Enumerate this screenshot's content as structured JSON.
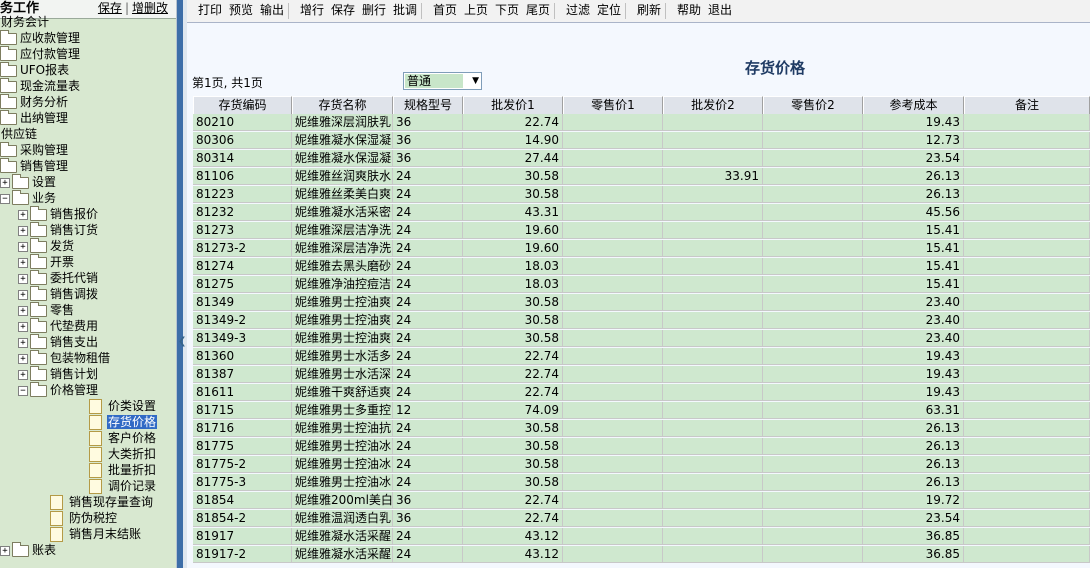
{
  "left_panel": {
    "title": "务工作",
    "save_label": "保存",
    "addremove_label": "增删改",
    "tree": [
      {
        "label": "财务会计",
        "depth": 0,
        "icon": "none",
        "expander": ""
      },
      {
        "label": "应收款管理",
        "depth": 1,
        "icon": "folder",
        "expander": ""
      },
      {
        "label": "应付款管理",
        "depth": 1,
        "icon": "folder",
        "expander": ""
      },
      {
        "label": "UFO报表",
        "depth": 1,
        "icon": "folder",
        "expander": ""
      },
      {
        "label": "现金流量表",
        "depth": 1,
        "icon": "folder",
        "expander": ""
      },
      {
        "label": "财务分析",
        "depth": 1,
        "icon": "folder",
        "expander": ""
      },
      {
        "label": "出纳管理",
        "depth": 1,
        "icon": "folder",
        "expander": ""
      },
      {
        "label": "供应链",
        "depth": 0,
        "icon": "none",
        "expander": ""
      },
      {
        "label": "采购管理",
        "depth": 1,
        "icon": "folder",
        "expander": ""
      },
      {
        "label": "销售管理",
        "depth": 1,
        "icon": "folder",
        "expander": ""
      },
      {
        "label": "设置",
        "depth": 2,
        "icon": "folder",
        "expander": "+"
      },
      {
        "label": "业务",
        "depth": 2,
        "icon": "folder",
        "expander": "-"
      },
      {
        "label": "销售报价",
        "depth": 3,
        "icon": "folder",
        "expander": "+"
      },
      {
        "label": "销售订货",
        "depth": 3,
        "icon": "folder",
        "expander": "+"
      },
      {
        "label": "发货",
        "depth": 3,
        "icon": "folder",
        "expander": "+"
      },
      {
        "label": "开票",
        "depth": 3,
        "icon": "folder",
        "expander": "+"
      },
      {
        "label": "委托代销",
        "depth": 3,
        "icon": "folder",
        "expander": "+"
      },
      {
        "label": "销售调拨",
        "depth": 3,
        "icon": "folder",
        "expander": "+"
      },
      {
        "label": "零售",
        "depth": 3,
        "icon": "folder",
        "expander": "+"
      },
      {
        "label": "代垫费用",
        "depth": 3,
        "icon": "folder",
        "expander": "+"
      },
      {
        "label": "销售支出",
        "depth": 3,
        "icon": "folder",
        "expander": "+"
      },
      {
        "label": "包装物租借",
        "depth": 3,
        "icon": "folder",
        "expander": "+"
      },
      {
        "label": "销售计划",
        "depth": 3,
        "icon": "folder",
        "expander": "+"
      },
      {
        "label": "价格管理",
        "depth": 3,
        "icon": "folder",
        "expander": "-"
      },
      {
        "label": "价类设置",
        "depth": 4,
        "icon": "doc",
        "expander": ""
      },
      {
        "label": "存货价格",
        "depth": 4,
        "icon": "doc",
        "expander": "",
        "selected": true
      },
      {
        "label": "客户价格",
        "depth": 4,
        "icon": "doc",
        "expander": ""
      },
      {
        "label": "大类折扣",
        "depth": 4,
        "icon": "doc",
        "expander": ""
      },
      {
        "label": "批量折扣",
        "depth": 4,
        "icon": "doc",
        "expander": ""
      },
      {
        "label": "调价记录",
        "depth": 4,
        "icon": "doc",
        "expander": ""
      },
      {
        "label": "销售现存量查询",
        "depth": 3,
        "icon": "doc",
        "expander": ""
      },
      {
        "label": "防伪税控",
        "depth": 3,
        "icon": "doc",
        "expander": ""
      },
      {
        "label": "销售月末结账",
        "depth": 3,
        "icon": "doc",
        "expander": ""
      },
      {
        "label": "账表",
        "depth": 2,
        "icon": "folder",
        "expander": "+"
      }
    ]
  },
  "toolbar": {
    "groups": [
      [
        "打印",
        "预览",
        "输出"
      ],
      [
        "增行",
        "保存",
        "删行",
        "批调"
      ],
      [
        "首页",
        "上页",
        "下页",
        "尾页"
      ],
      [
        "过滤",
        "定位"
      ],
      [
        "刷新"
      ],
      [
        "帮助",
        "退出"
      ]
    ]
  },
  "report": {
    "title": "存货价格",
    "page_info": "第1页, 共1页",
    "type_select": "普通"
  },
  "grid": {
    "columns": [
      "存货编码",
      "存货名称",
      "规格型号",
      "批发价1",
      "零售价1",
      "批发价2",
      "零售价2",
      "参考成本",
      "备注"
    ],
    "rows": [
      [
        "80210",
        "妮维雅深层润肤乳",
        "36",
        "22.74",
        "",
        "",
        "",
        "19.43",
        ""
      ],
      [
        "80306",
        "妮维雅凝水保湿凝",
        "36",
        "14.90",
        "",
        "",
        "",
        "12.73",
        ""
      ],
      [
        "80314",
        "妮维雅凝水保湿凝",
        "36",
        "27.44",
        "",
        "",
        "",
        "23.54",
        ""
      ],
      [
        "81106",
        "妮维雅丝润爽肤水",
        "24",
        "30.58",
        "",
        "33.91",
        "",
        "26.13",
        ""
      ],
      [
        "81223",
        "妮维雅丝柔美白爽",
        "24",
        "30.58",
        "",
        "",
        "",
        "26.13",
        ""
      ],
      [
        "81232",
        "妮维雅凝水活采密",
        "24",
        "43.31",
        "",
        "",
        "",
        "45.56",
        ""
      ],
      [
        "81273",
        "妮维雅深层洁净洗",
        "24",
        "19.60",
        "",
        "",
        "",
        "15.41",
        ""
      ],
      [
        "81273-2",
        "妮维雅深层洁净洗",
        "24",
        "19.60",
        "",
        "",
        "",
        "15.41",
        ""
      ],
      [
        "81274",
        "妮维雅去黑头磨砂",
        "24",
        "18.03",
        "",
        "",
        "",
        "15.41",
        ""
      ],
      [
        "81275",
        "妮维雅净油控痘洁",
        "24",
        "18.03",
        "",
        "",
        "",
        "15.41",
        ""
      ],
      [
        "81349",
        "妮维雅男士控油爽",
        "24",
        "30.58",
        "",
        "",
        "",
        "23.40",
        ""
      ],
      [
        "81349-2",
        "妮维雅男士控油爽",
        "24",
        "30.58",
        "",
        "",
        "",
        "23.40",
        ""
      ],
      [
        "81349-3",
        "妮维雅男士控油爽",
        "24",
        "30.58",
        "",
        "",
        "",
        "23.40",
        ""
      ],
      [
        "81360",
        "妮维雅男士水活多",
        "24",
        "22.74",
        "",
        "",
        "",
        "19.43",
        ""
      ],
      [
        "81387",
        "妮维雅男士水活深",
        "24",
        "22.74",
        "",
        "",
        "",
        "19.43",
        ""
      ],
      [
        "81611",
        "妮维雅干爽舒适爽",
        "24",
        "22.74",
        "",
        "",
        "",
        "19.43",
        ""
      ],
      [
        "81715",
        "妮维雅男士多重控",
        "12",
        "74.09",
        "",
        "",
        "",
        "63.31",
        ""
      ],
      [
        "81716",
        "妮维雅男士控油抗",
        "24",
        "30.58",
        "",
        "",
        "",
        "26.13",
        ""
      ],
      [
        "81775",
        "妮维雅男士控油冰",
        "24",
        "30.58",
        "",
        "",
        "",
        "26.13",
        ""
      ],
      [
        "81775-2",
        "妮维雅男士控油冰",
        "24",
        "30.58",
        "",
        "",
        "",
        "26.13",
        ""
      ],
      [
        "81775-3",
        "妮维雅男士控油冰",
        "24",
        "30.58",
        "",
        "",
        "",
        "26.13",
        ""
      ],
      [
        "81854",
        "妮维雅200ml美白润",
        "36",
        "22.74",
        "",
        "",
        "",
        "19.72",
        ""
      ],
      [
        "81854-2",
        "妮维雅温润透白乳",
        "36",
        "22.74",
        "",
        "",
        "",
        "23.54",
        ""
      ],
      [
        "81917",
        "妮维雅凝水活采醒",
        "24",
        "43.12",
        "",
        "",
        "",
        "36.85",
        ""
      ],
      [
        "81917-2",
        "妮维雅凝水活采醒",
        "24",
        "43.12",
        "",
        "",
        "",
        "36.85",
        ""
      ]
    ]
  }
}
